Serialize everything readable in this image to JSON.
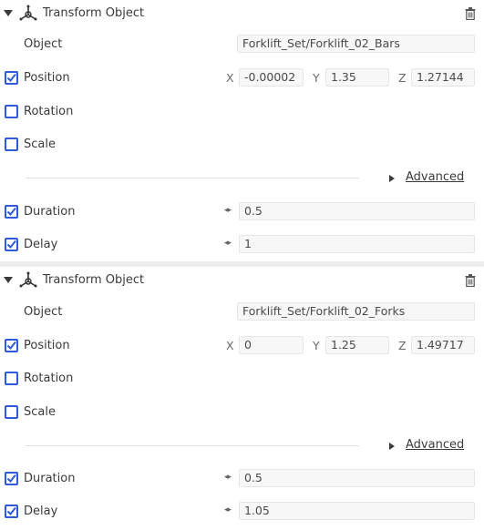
{
  "components": [
    {
      "title": "Transform Object",
      "object_label": "Object",
      "object_value": "Forklift_Set/Forklift_02_Bars",
      "position": {
        "label": "Position",
        "checked": true,
        "x_label": "X",
        "x": "-0.00002",
        "y_label": "Y",
        "y": "1.35",
        "z_label": "Z",
        "z": "1.27144"
      },
      "rotation": {
        "label": "Rotation",
        "checked": false
      },
      "scale": {
        "label": "Scale",
        "checked": false
      },
      "advanced_label": "Advanced",
      "duration": {
        "label": "Duration",
        "checked": true,
        "value": "0.5"
      },
      "delay": {
        "label": "Delay",
        "checked": true,
        "value": "1"
      }
    },
    {
      "title": "Transform Object",
      "object_label": "Object",
      "object_value": "Forklift_Set/Forklift_02_Forks",
      "position": {
        "label": "Position",
        "checked": true,
        "x_label": "X",
        "x": "0",
        "y_label": "Y",
        "y": "1.25",
        "z_label": "Z",
        "z": "1.49717"
      },
      "rotation": {
        "label": "Rotation",
        "checked": false
      },
      "scale": {
        "label": "Scale",
        "checked": false
      },
      "advanced_label": "Advanced",
      "duration": {
        "label": "Duration",
        "checked": true,
        "value": "0.5"
      },
      "delay": {
        "label": "Delay",
        "checked": true,
        "value": "1.05"
      }
    }
  ],
  "icons": {
    "gizmo": "transform-gizmo-icon",
    "trash": "trash-icon",
    "drag": "drag-arrows-icon",
    "expand": "triangle-right-icon",
    "collapse": "triangle-down-icon"
  },
  "colors": {
    "checkbox_accent": "#2f5bd6",
    "panel_bg": "#ffffff",
    "page_bg": "#ececec",
    "field_bg": "#f7f7f7"
  }
}
